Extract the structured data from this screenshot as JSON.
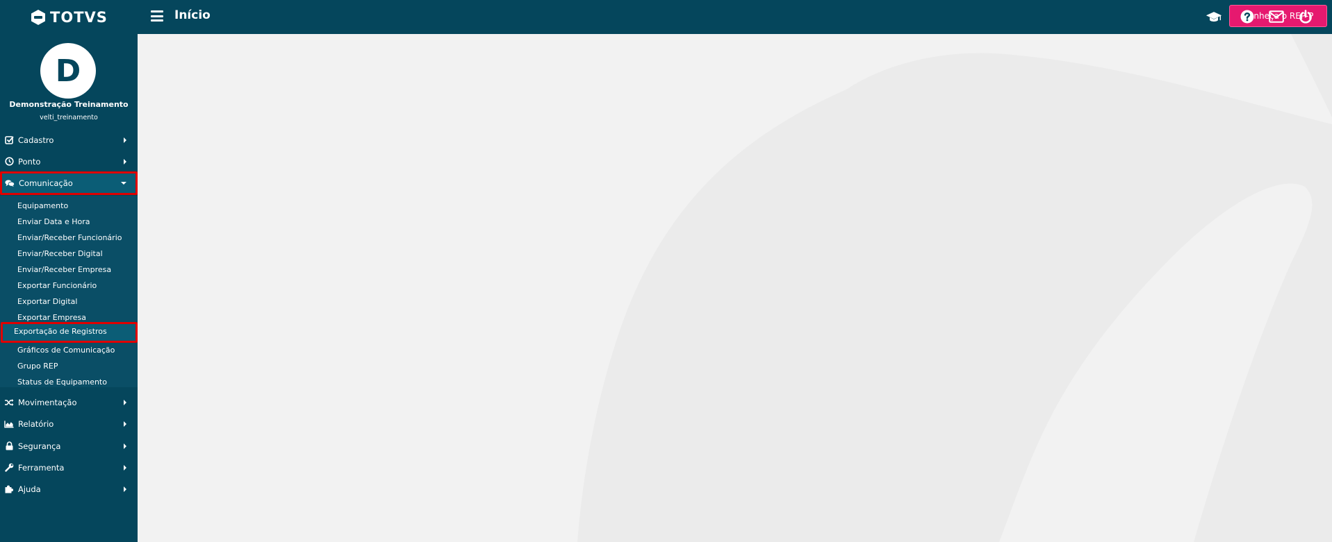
{
  "brand": {
    "name": "TOTVS"
  },
  "header": {
    "title": "Início",
    "cta_label": "Conheça o REP-P",
    "icons": [
      "graduation-cap-icon",
      "help-icon",
      "envelope-icon",
      "power-icon"
    ]
  },
  "user": {
    "initial": "D",
    "name": "Demonstração Treinamento",
    "login": "velti_treinamento"
  },
  "sidebar": {
    "items": [
      {
        "label": "Cadastro",
        "icon": "check-square-icon"
      },
      {
        "label": "Ponto",
        "icon": "clock-icon"
      },
      {
        "label": "Comunicação",
        "icon": "comments-icon",
        "expanded": true
      },
      {
        "label": "Movimentação",
        "icon": "shuffle-icon"
      },
      {
        "label": "Relatório",
        "icon": "area-chart-icon"
      },
      {
        "label": "Segurança",
        "icon": "lock-icon"
      },
      {
        "label": "Ferramenta",
        "icon": "wrench-icon"
      },
      {
        "label": "Ajuda",
        "icon": "puzzle-icon"
      }
    ],
    "comunicacao_sub": [
      "Equipamento",
      "Enviar Data e Hora",
      "Enviar/Receber Funcionário",
      "Enviar/Receber Digital",
      "Enviar/Receber Empresa",
      "Exportar Funcionário",
      "Exportar Digital",
      "Exportar Empresa",
      "Exportação de Registros",
      "Gráficos de Comunicação",
      "Grupo REP",
      "Status de Equipamento"
    ]
  },
  "colors": {
    "sidebar_bg": "#05465c",
    "submenu_bg": "#0a4e66",
    "active_bg": "#0b5d76",
    "highlight_border": "#e00000",
    "cta_bg": "#e6196f",
    "content_bg": "#f2f2f2"
  }
}
